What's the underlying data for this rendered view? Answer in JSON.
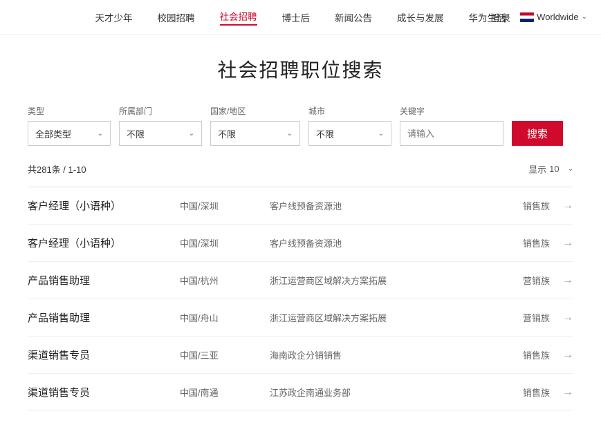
{
  "nav": {
    "links": [
      {
        "label": "天才少年",
        "active": false
      },
      {
        "label": "校园招聘",
        "active": false
      },
      {
        "label": "社会招聘",
        "active": true
      },
      {
        "label": "博士后",
        "active": false
      },
      {
        "label": "新闻公告",
        "active": false
      },
      {
        "label": "成长与发展",
        "active": false
      },
      {
        "label": "华为生活",
        "active": false
      }
    ],
    "login_label": "登录",
    "worldwide_label": "Worldwide"
  },
  "page": {
    "title": "社会招聘职位搜索"
  },
  "filters": {
    "type_label": "类型",
    "type_value": "全部类型",
    "dept_label": "所属部门",
    "dept_value": "不限",
    "country_label": "国家/地区",
    "country_value": "不限",
    "city_label": "城市",
    "city_value": "不限",
    "keyword_label": "关键字",
    "keyword_placeholder": "请输入",
    "search_label": "搜索"
  },
  "results": {
    "count_label": "共281条 / 1-10",
    "display_label": "显示",
    "display_value": "10"
  },
  "jobs": [
    {
      "title": "客户经理（小语种）",
      "location": "中国/深圳",
      "dept": "客户线预备资源池",
      "category": "销售族"
    },
    {
      "title": "客户经理（小语种）",
      "location": "中国/深圳",
      "dept": "客户线预备资源池",
      "category": "销售族"
    },
    {
      "title": "产品销售助理",
      "location": "中国/杭州",
      "dept": "浙江运营商区域解决方案拓展",
      "category": "营销族"
    },
    {
      "title": "产品销售助理",
      "location": "中国/舟山",
      "dept": "浙江运营商区域解决方案拓展",
      "category": "营销族"
    },
    {
      "title": "渠道销售专员",
      "location": "中国/三亚",
      "dept": "海南政企分销销售",
      "category": "销售族"
    },
    {
      "title": "渠道销售专员",
      "location": "中国/南通",
      "dept": "江苏政企南通业务部",
      "category": "销售族"
    }
  ]
}
